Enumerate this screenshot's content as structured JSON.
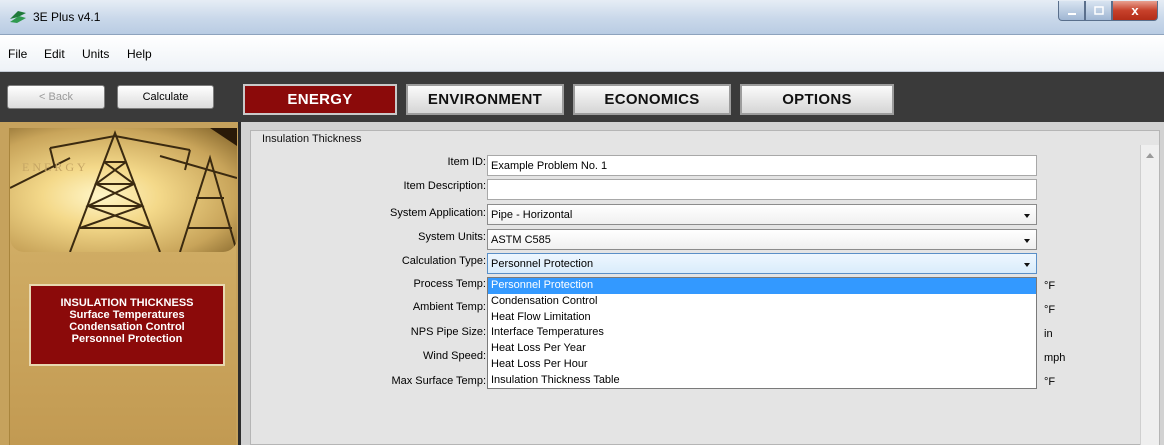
{
  "window": {
    "title": "3E Plus v4.1",
    "buttons": [
      "minimize",
      "maximize",
      "close"
    ],
    "close_glyph": "x"
  },
  "menu": [
    "File",
    "Edit",
    "Units",
    "Help"
  ],
  "toolbar": {
    "back_label": "< Back",
    "calculate_label": "Calculate",
    "tabs": [
      "ENERGY",
      "ENVIRONMENT",
      "ECONOMICS",
      "OPTIONS"
    ],
    "active_tab": "ENERGY"
  },
  "sidebar": {
    "image_text": "ENERGY",
    "menu_items": [
      "INSULATION THICKNESS",
      "Surface Temperatures",
      "Condensation Control",
      "Personnel Protection"
    ]
  },
  "form": {
    "title": "Insulation Thickness",
    "labels": {
      "item_id": "Item ID:",
      "item_description": "Item Description:",
      "system_application": "System Application:",
      "system_units": "System Units:",
      "calculation_type": "Calculation Type:",
      "process_temp": "Process Temp:",
      "ambient_temp": "Ambient Temp:",
      "nps_pipe_size": "NPS Pipe Size:",
      "wind_speed": "Wind Speed:",
      "max_surface_temp": "Max Surface Temp:"
    },
    "values": {
      "item_id": "Example Problem No. 1",
      "item_description": "",
      "system_application": "Pipe - Horizontal",
      "system_units": "ASTM C585",
      "calculation_type": "Personnel Protection"
    },
    "units": {
      "process_temp": "°F",
      "ambient_temp": "°F",
      "nps_pipe_size": "in",
      "wind_speed": "mph",
      "max_surface_temp": "°F"
    },
    "dropdown_options": [
      "Personnel Protection",
      "Condensation Control",
      "Heat Flow Limitation",
      "Interface Temperatures",
      "Heat Loss Per Year",
      "Heat Loss Per Hour",
      "Insulation Thickness Table"
    ],
    "dropdown_selected": "Personnel Protection"
  },
  "colors": {
    "accent_red": "#8b0a0a",
    "selection_blue": "#3399ff",
    "sidebar_gold": "#c6a25d"
  }
}
